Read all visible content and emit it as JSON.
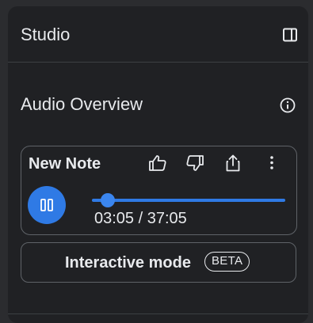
{
  "header": {
    "title": "Studio",
    "collapse_icon": "side-panel-icon"
  },
  "audio_overview": {
    "title": "Audio Overview",
    "info_icon": "info-icon",
    "card": {
      "title": "New Note",
      "actions": [
        "thumb-up-icon",
        "thumb-down-icon",
        "share-icon",
        "more-vert-icon"
      ],
      "play_state_icon": "pause-icon",
      "progress_fraction": 0.083,
      "time_display": "03:05 / 37:05"
    },
    "interactive": {
      "label": "Interactive mode",
      "badge": "BETA"
    }
  },
  "colors": {
    "accent": "#2f7ae5",
    "panel_bg": "#202124",
    "page_bg": "#2b2c2f",
    "text": "#e8eaed",
    "border": "#5f6368"
  }
}
